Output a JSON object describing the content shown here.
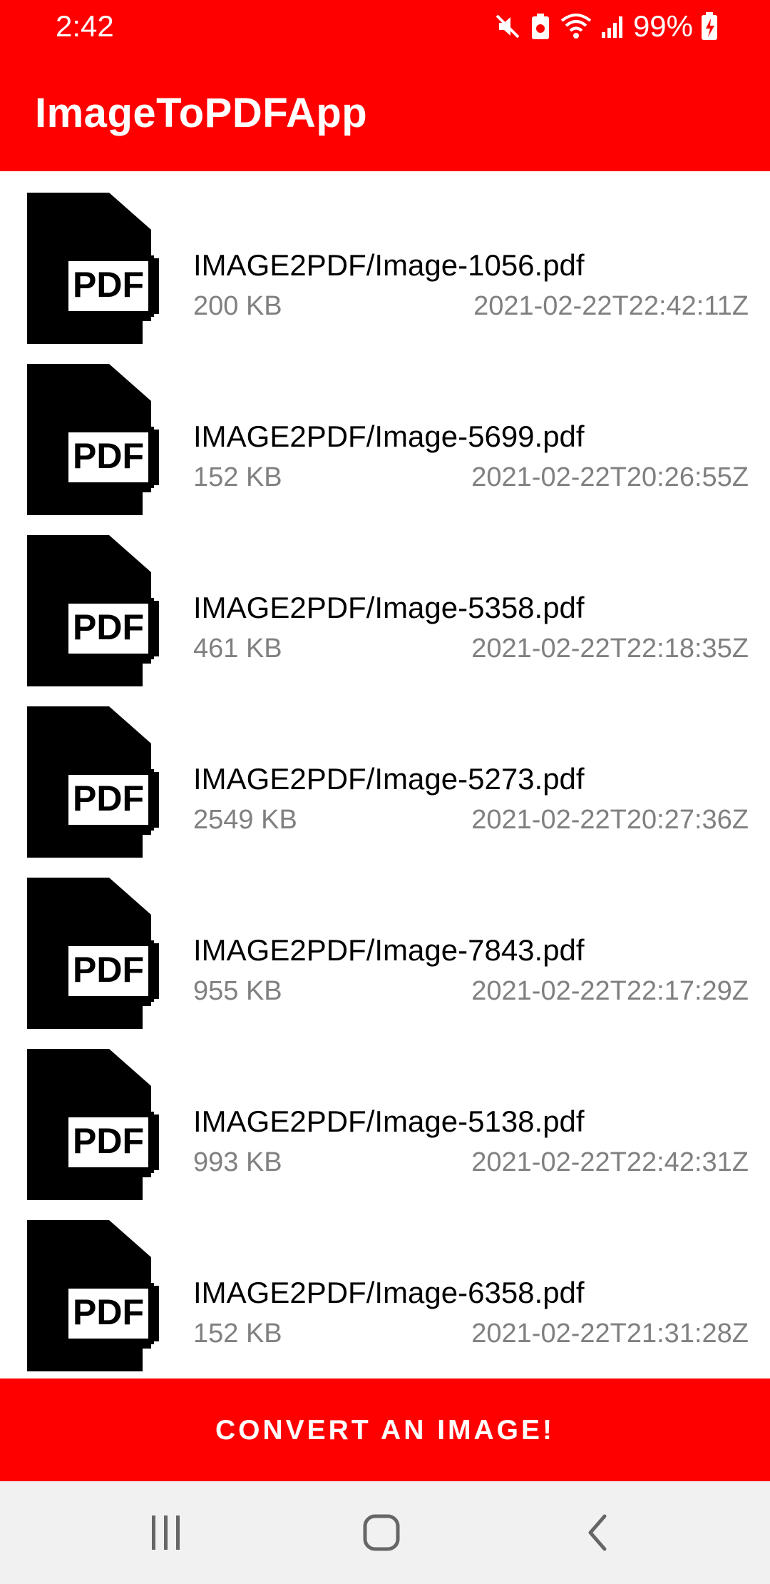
{
  "status_bar": {
    "time": "2:42",
    "battery": "99%",
    "icons": [
      "mute-icon",
      "battery-saver-icon",
      "wifi-icon",
      "signal-icon",
      "battery-charging-icon"
    ]
  },
  "app_bar": {
    "title": "ImageToPDFApp",
    "color": "#ff0000"
  },
  "files": [
    {
      "icon": "pdf-file-icon",
      "name": "IMAGE2PDF/Image-1056.pdf",
      "size": "200 KB",
      "date": "2021-02-22T22:42:11Z"
    },
    {
      "icon": "pdf-file-icon",
      "name": "IMAGE2PDF/Image-5699.pdf",
      "size": "152 KB",
      "date": "2021-02-22T20:26:55Z"
    },
    {
      "icon": "pdf-file-icon",
      "name": "IMAGE2PDF/Image-5358.pdf",
      "size": "461 KB",
      "date": "2021-02-22T22:18:35Z"
    },
    {
      "icon": "pdf-file-icon",
      "name": "IMAGE2PDF/Image-5273.pdf",
      "size": "2549 KB",
      "date": "2021-02-22T20:27:36Z"
    },
    {
      "icon": "pdf-file-icon",
      "name": "IMAGE2PDF/Image-7843.pdf",
      "size": "955 KB",
      "date": "2021-02-22T22:17:29Z"
    },
    {
      "icon": "pdf-file-icon",
      "name": "IMAGE2PDF/Image-5138.pdf",
      "size": "993 KB",
      "date": "2021-02-22T22:42:31Z"
    },
    {
      "icon": "pdf-file-icon",
      "name": "IMAGE2PDF/Image-6358.pdf",
      "size": "152 KB",
      "date": "2021-02-22T21:31:28Z"
    }
  ],
  "pdf_icon_label": "PDF",
  "convert_button": {
    "label": "CONVERT AN IMAGE!"
  },
  "nav_bar": {
    "buttons": [
      "recent-apps-icon",
      "home-icon",
      "back-icon"
    ]
  }
}
